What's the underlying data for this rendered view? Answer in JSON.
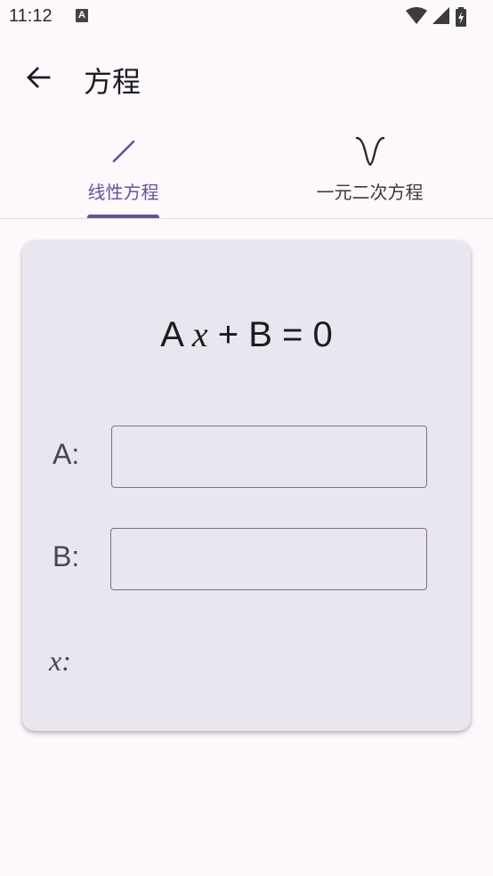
{
  "status_bar": {
    "time": "11:12",
    "notification_icon": "a-icon",
    "notification_glyph": "A",
    "icons": [
      "wifi-icon",
      "signal-icon",
      "battery-charging-icon"
    ]
  },
  "app_bar": {
    "back_icon": "arrow-back-icon",
    "title": "方程"
  },
  "tabs": [
    {
      "label": "线性方程",
      "icon": "linear-icon",
      "selected": true
    },
    {
      "label": "一元二次方程",
      "icon": "parabola-icon",
      "selected": false
    }
  ],
  "equation": {
    "coef_a": "A",
    "variable": "x",
    "rest": "+ B = 0"
  },
  "fields": {
    "a_label": "A:",
    "a_value": "",
    "b_label": "B:",
    "b_value": "",
    "x_label": "x:",
    "x_value": ""
  },
  "colors": {
    "accent": "#6750a4",
    "card_background": "#e9e6ef",
    "page_background": "#fdf8fc"
  }
}
